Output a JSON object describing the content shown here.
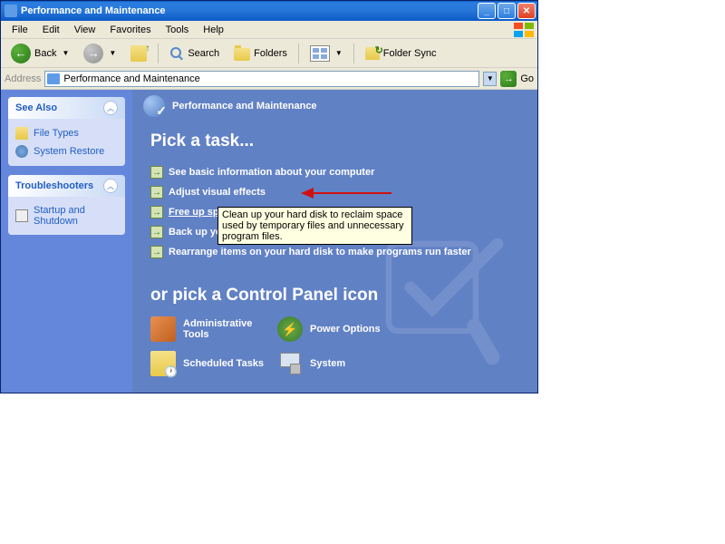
{
  "window": {
    "title": "Performance and Maintenance"
  },
  "menu": {
    "file": "File",
    "edit": "Edit",
    "view": "View",
    "favorites": "Favorites",
    "tools": "Tools",
    "help": "Help"
  },
  "toolbar": {
    "back": "Back",
    "search": "Search",
    "folders": "Folders",
    "foldersync": "Folder Sync"
  },
  "address": {
    "label": "Address",
    "value": "Performance and Maintenance",
    "go": "Go"
  },
  "sidebar": {
    "see_also": {
      "title": "See Also",
      "file_types": "File Types",
      "system_restore": "System Restore"
    },
    "troubleshooters": {
      "title": "Troubleshooters",
      "startup": "Startup and Shutdown"
    }
  },
  "main": {
    "header": "Performance and Maintenance",
    "pick_task": "Pick a task...",
    "tasks": {
      "basic_info": "See basic information about your computer",
      "visual_effects": "Adjust visual effects",
      "free_space": "Free up space on your hard disk",
      "backup": "Back up your data",
      "rearrange": "Rearrange items on your hard disk to make programs run faster"
    },
    "tooltip": "Clean up your hard disk to reclaim space used by temporary files and unnecessary program files.",
    "pick_icon": "or pick a Control Panel icon",
    "icons": {
      "admin_tools": "Administrative Tools",
      "power_options": "Power Options",
      "scheduled_tasks": "Scheduled Tasks",
      "system": "System"
    }
  }
}
